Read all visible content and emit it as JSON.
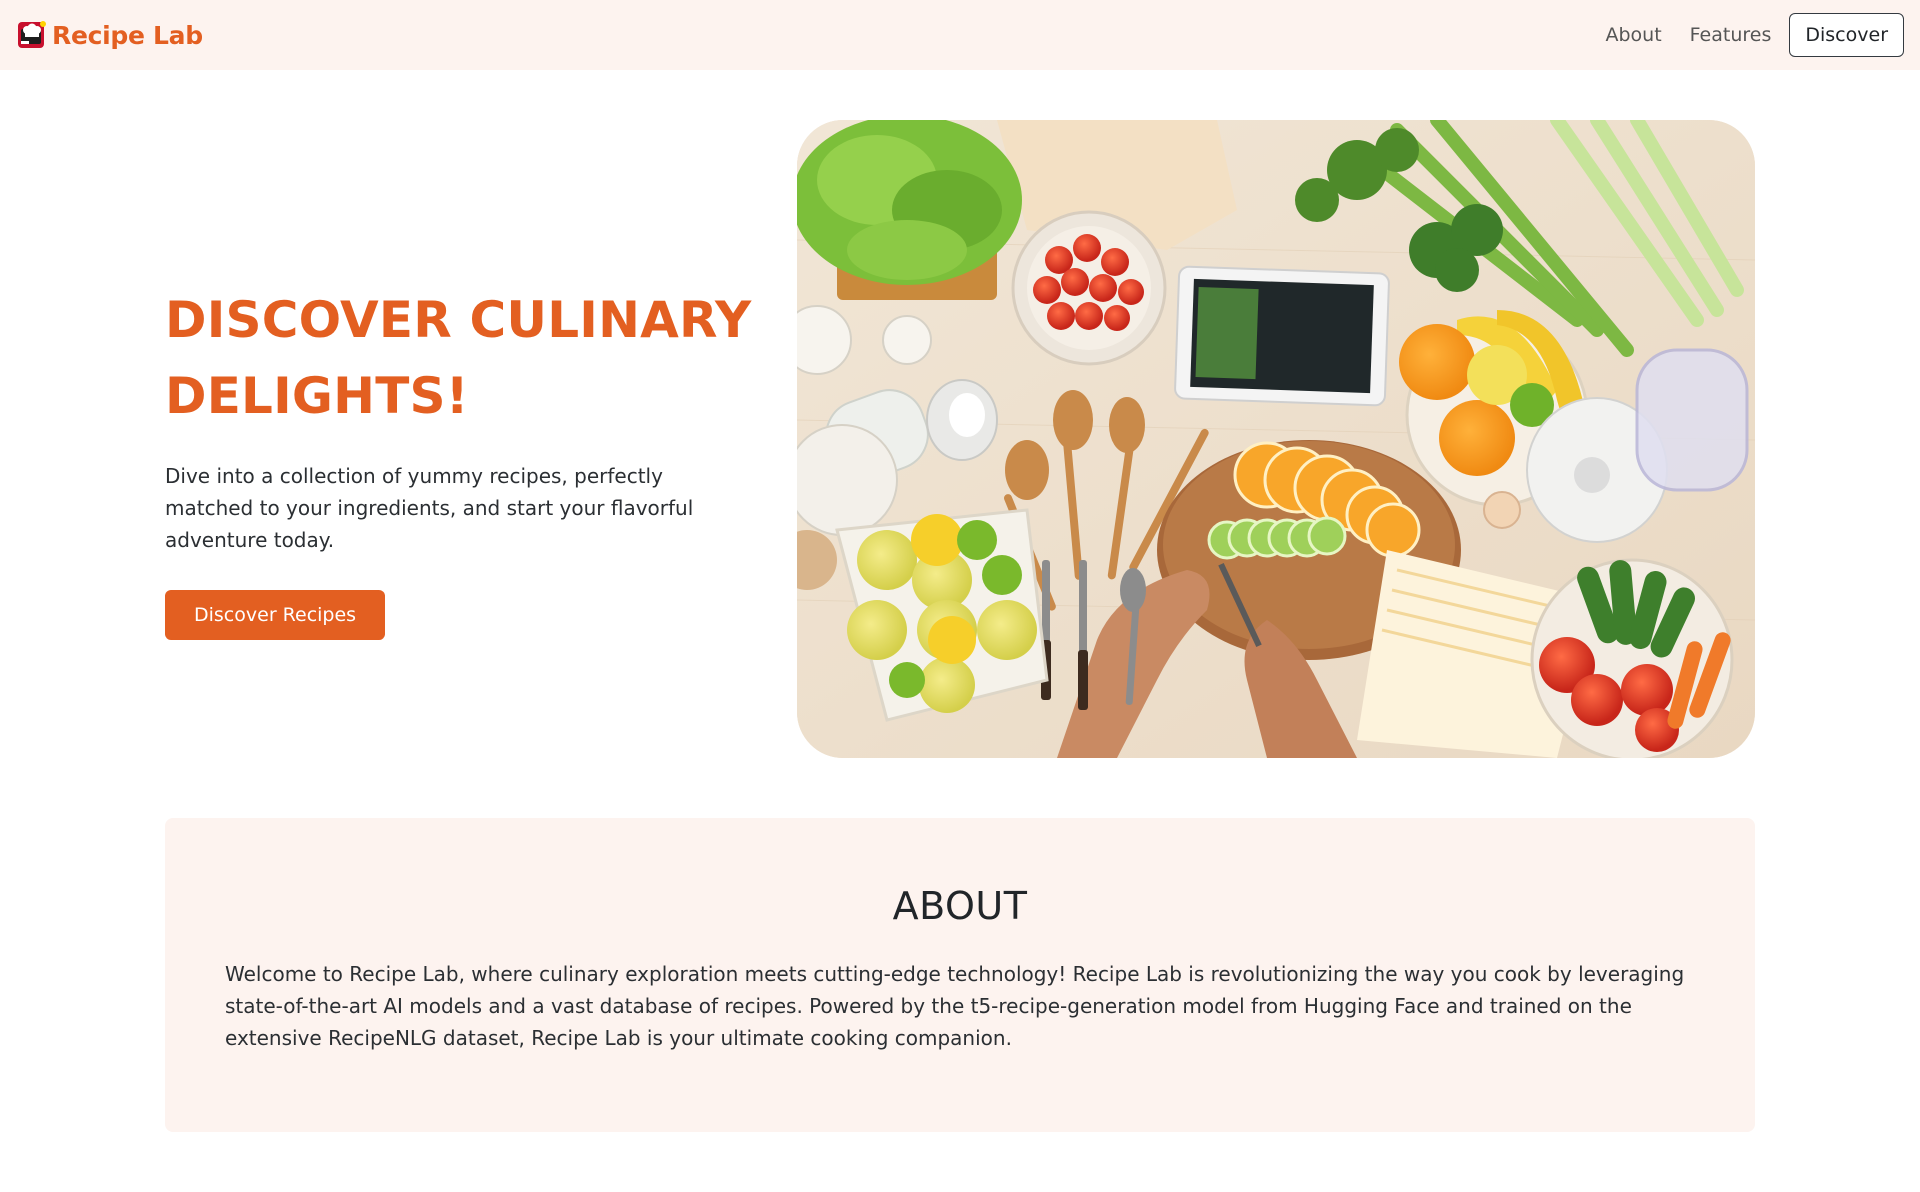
{
  "navbar": {
    "brand": "Recipe Lab",
    "logo_icon": "chef-hat-icon",
    "links": [
      "About",
      "Features"
    ],
    "cta": "Discover"
  },
  "hero": {
    "title": "DISCOVER CULINARY DELIGHTS!",
    "description": "Dive into a collection of yummy recipes, perfectly matched to your ingredients, and start your flavorful adventure today.",
    "button": "Discover Recipes",
    "image_alt": "Top view of a kitchen table with vegetables, fruits, a cutting board, utensils and a tablet"
  },
  "about": {
    "title": "ABOUT",
    "text": "Welcome to Recipe Lab, where culinary exploration meets cutting-edge technology! Recipe Lab is revolutionizing the way you cook by leveraging state-of-the-art AI models and a vast database of recipes. Powered by the t5-recipe-generation model from Hugging Face and trained on the extensive RecipeNLG dataset, Recipe Lab is your ultimate cooking companion."
  },
  "colors": {
    "accent": "#e35f21",
    "navbar_bg": "#fdf3ef",
    "section_bg": "#fdf3ef"
  }
}
